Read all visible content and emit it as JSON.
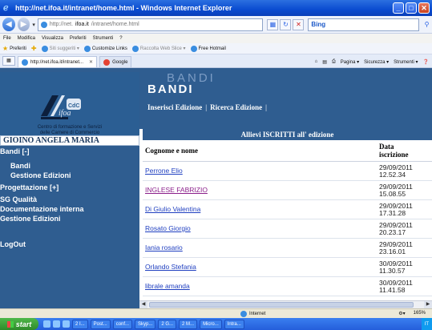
{
  "window": {
    "title": "http://net.ifoa.it/intranet/home.html - Windows Internet Explorer",
    "min_label": "_",
    "max_label": "□",
    "close_label": "✕"
  },
  "address": {
    "url_prefix": "http://net.",
    "url_host": "ifoa.it",
    "url_suffix": "/intranet/home.html",
    "search_engine": "Bing",
    "search_placeholder": "Bing"
  },
  "menu": [
    "File",
    "Modifica",
    "Visualizza",
    "Preferiti",
    "Strumenti",
    "?"
  ],
  "favorites": {
    "label": "Preferiti",
    "items": [
      "Siti suggeriti ▾",
      "Customize Links",
      "Raccolta Web Slice ▾",
      "Free Hotmail"
    ]
  },
  "tabs": {
    "items": [
      "http://net.ifoa.it/intranet...",
      "Google"
    ],
    "tools": [
      "Pagina ▾",
      "Sicurezza ▾",
      "Strumenti ▾"
    ]
  },
  "sidebar": {
    "logo_name": "ifoa",
    "logo_caption_1": "Centro di formazione e Servizi",
    "logo_caption_2": "delle Camere di Commercio",
    "user": "GIOINO ANGELA MARIA",
    "nav": [
      {
        "label": "Bandi [-]",
        "level": 0
      },
      {
        "label": "Bandi",
        "level": 1
      },
      {
        "label": "Gestione Edizioni",
        "level": 1
      },
      {
        "label": "Progettazione [+]",
        "level": 0
      },
      {
        "label": "SG Qualità",
        "level": 0
      },
      {
        "label": "Documentazione interna",
        "level": 0
      },
      {
        "label": "Gestione Edizioni",
        "level": 0
      }
    ],
    "logout": "LogOut"
  },
  "banner": {
    "ghost": "BANDI",
    "title": "BANDI",
    "link_1": "Inserisci Edizione",
    "sep_1": "|",
    "link_2": "Ricerca Edizione",
    "sep_2": "|"
  },
  "table": {
    "caption": "Allievi ISCRITTI all' edizione",
    "col_name": "Cognome e nome",
    "col_date_1": "Data",
    "col_date_2": "iscrizione",
    "rows": [
      {
        "name": "Perrone Elio",
        "date": "29/09/2011",
        "time": "12.52.34"
      },
      {
        "name": "INGLESE FABRIZIO",
        "date": "29/09/2011",
        "time": "15.08.55"
      },
      {
        "name": "Di Giulio Valentina",
        "date": "29/09/2011",
        "time": "17.31.28"
      },
      {
        "name": "Rosato Giorgio",
        "date": "29/09/2011",
        "time": "20.23.17"
      },
      {
        "name": "Iania rosario",
        "date": "29/09/2011",
        "time": "23.16.01"
      },
      {
        "name": "Orlando Stefania",
        "date": "30/09/2011",
        "time": "11.30.57"
      },
      {
        "name": "librale amanda",
        "date": "30/09/2011",
        "time": "11.41.58"
      }
    ]
  },
  "status": {
    "zone": "Internet",
    "zoom": "165%"
  },
  "taskbar": {
    "start": "start",
    "tasks": [
      "2 I...",
      "Post...",
      "conf...",
      "Skyp...",
      "2 G...",
      "2 M...",
      "Micro...",
      "Intra..."
    ],
    "clock": "IT"
  }
}
